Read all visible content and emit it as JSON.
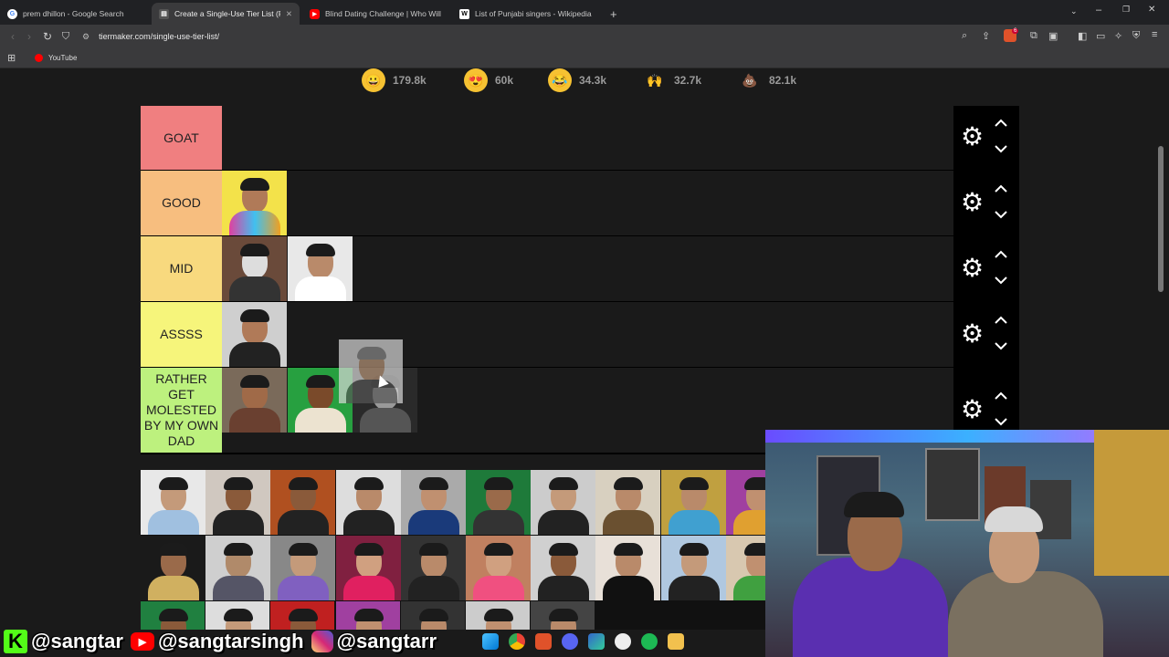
{
  "browser": {
    "tabs": [
      {
        "title": "prem dhillon - Google Search",
        "icon": "google-icon"
      },
      {
        "title": "Create a Single-Use Tier List (Pri",
        "icon": "tiermaker-icon",
        "active": true
      },
      {
        "title": "Blind Dating Challenge | Who Will Ki",
        "icon": "youtube-icon"
      },
      {
        "title": "List of Punjabi singers - Wikipedia",
        "icon": "wikipedia-icon"
      }
    ],
    "new_tab": "+",
    "url": "tiermaker.com/single-use-tier-list/",
    "bookmarks": [
      {
        "label": "YouTube",
        "icon": "youtube-icon"
      }
    ],
    "extension_badge": "6"
  },
  "reactions": [
    {
      "emoji": "😀",
      "count": "179.8k"
    },
    {
      "emoji": "😍",
      "count": "60k"
    },
    {
      "emoji": "😂",
      "count": "34.3k"
    },
    {
      "emoji": "🙌",
      "count": "32.7k"
    },
    {
      "emoji": "💩",
      "count": "82.1k"
    }
  ],
  "tiers": [
    {
      "label": "GOAT",
      "color": "#f07f80"
    },
    {
      "label": "GOOD",
      "color": "#f7be7f"
    },
    {
      "label": "MID",
      "color": "#f8d97e"
    },
    {
      "label": "ASSSS",
      "color": "#f6f57b"
    },
    {
      "label": "RATHER GET MOLESTED BY MY OWN DAD",
      "color": "#bdf17e"
    }
  ],
  "social": {
    "kick": "@sangtar",
    "youtube": "@sangtarsingh",
    "instagram": "@sangtarr"
  }
}
